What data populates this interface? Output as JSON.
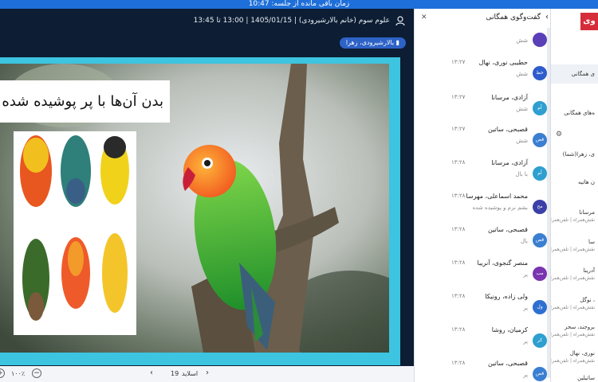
{
  "topbar": {
    "text": "زمان باقی مانده از جلسه: 10:47"
  },
  "class_header": {
    "info": "علوم سوم (خانم بالارشیرودی) | 1405/01/15 | 13:00 تا 13:45",
    "presenter": "بالارشیرودی، زهرا"
  },
  "slide": {
    "title": "بدن آن‌ها با پر پوشیده شده اس"
  },
  "bottom": {
    "zoom": "۱۰۰٪",
    "slide_number": "19",
    "slide_label": "اسلاید"
  },
  "chat": {
    "title": "گفت‌وگوی همگانی",
    "messages": [
      {
        "initials": "",
        "name": "",
        "time": "",
        "text": "شش",
        "color": "#5a3fb8"
      },
      {
        "initials": "خط",
        "name": "حطیبی نوری، نهال",
        "time": "۱۳:۲۷",
        "text": "شش",
        "color": "#2e5ccc"
      },
      {
        "initials": "آم",
        "name": "آزادی، مرسانا",
        "time": "۱۳:۲۷",
        "text": "شش",
        "color": "#2e9fcf"
      },
      {
        "initials": "قص",
        "name": "قصبحی، ساتین",
        "time": "۱۳:۲۷",
        "text": "شش",
        "color": "#3a7fd1"
      },
      {
        "initials": "آم",
        "name": "آزادی، مرسانا",
        "time": "۱۳:۲۸",
        "text": "با بال",
        "color": "#2e9fcf"
      },
      {
        "initials": "مح",
        "name": "محمد اسماعلی، مهرسا",
        "time": "۱۳:۲۸",
        "text": "بشم نرم و پوشیده شده",
        "color": "#3b3fa8"
      },
      {
        "initials": "قص",
        "name": "قصبحی، ساتین",
        "time": "۱۳:۲۸",
        "text": "بال",
        "color": "#3a7fd1"
      },
      {
        "initials": "مب",
        "name": "منصر گنجوی، آنریبا",
        "time": "۱۳:۲۸",
        "text": "پر",
        "color": "#7a34b0"
      },
      {
        "initials": "ول",
        "name": "ولی زاده، رونیکا",
        "time": "۱۳:۲۸",
        "text": "پر",
        "color": "#2e6fd1"
      },
      {
        "initials": "کر",
        "name": "کرمیان، روشا",
        "time": "۱۳:۲۸",
        "text": "پر",
        "color": "#2e9fcf"
      },
      {
        "initials": "قص",
        "name": "قصبحی، ساتین",
        "time": "۱۳:۲۸",
        "text": "پر",
        "color": "#3a7fd1"
      }
    ]
  },
  "right_panel": {
    "logo": "وی",
    "items": [
      {
        "label": "ی همگانی",
        "sub": "",
        "active": true
      },
      {
        "label": "ه‌های همگانی",
        "sub": ""
      },
      {
        "label": "ی، زهرا(شما)",
        "sub": ""
      },
      {
        "label": "ن هاتیه",
        "sub": ""
      },
      {
        "label": "مرسانا",
        "sub": "نقش‌همراه | تلفن‌همراه"
      },
      {
        "label": "سا",
        "sub": "نقش‌همراه | تلفن‌همراه"
      },
      {
        "label": "آدرینا",
        "sub": "نقش‌همراه | تلفن‌همراه"
      },
      {
        "label": "، نوگل",
        "sub": "نقش‌همراه | تلفن‌همراه"
      },
      {
        "label": "بروجند، سحر",
        "sub": "نقش‌همراه | تلفن‌همراه"
      },
      {
        "label": "نوری، نهال",
        "sub": "نقش‌همراه | تلفن‌همراه"
      },
      {
        "label": "ساتیلین",
        "sub": "نقش‌همراه"
      }
    ]
  }
}
